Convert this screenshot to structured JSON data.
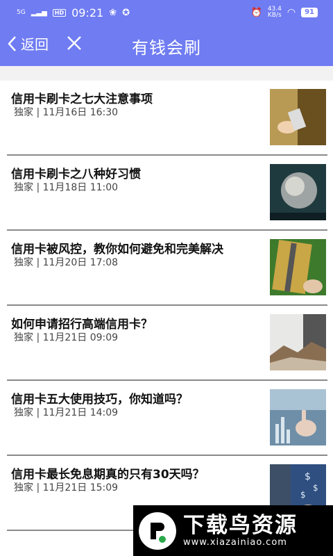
{
  "status_bar": {
    "network": "5G",
    "hd": "HD",
    "time": "09:21",
    "speed_value": "43.4",
    "speed_unit": "KB/s",
    "battery": "91"
  },
  "nav": {
    "back_label": "返回",
    "title": "有钱会刷"
  },
  "articles": [
    {
      "title": "信用卡刷卡之七大注意事项",
      "meta": "独家 | 11月16日 16:30"
    },
    {
      "title": "信用卡刷卡之八种好习惯",
      "meta": "独家 | 11月18日 11:00"
    },
    {
      "title": "信用卡被风控，教你如何避免和完美解决",
      "meta": "独家 | 11月20日 17:08"
    },
    {
      "title": "如何申请招行高端信用卡？",
      "meta": "独家 | 11月21日 09:09"
    },
    {
      "title": "信用卡五大使用技巧，你知道吗？",
      "meta": "独家 | 11月21日 14:09"
    },
    {
      "title": "信用卡最长免息期真的只有30天吗？",
      "meta": "独家 | 11月21日 15:09"
    }
  ],
  "watermark": {
    "name": "下载鸟资源",
    "url": "www.xiazainiao.com"
  },
  "colors": {
    "header": "#6f7cf2",
    "divider": "#8a8a8a"
  }
}
